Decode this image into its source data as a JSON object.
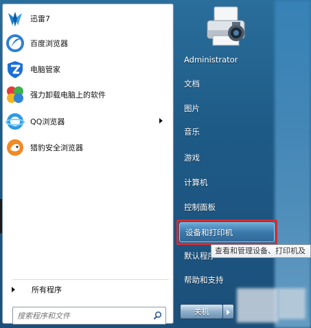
{
  "apps": [
    {
      "label": "迅雷7",
      "icon": "xunlei-icon"
    },
    {
      "label": "百度浏览器",
      "icon": "baidu-browser-icon"
    },
    {
      "label": "电脑管家",
      "icon": "pc-manager-shield-icon"
    },
    {
      "label": "强力卸载电脑上的软件",
      "icon": "uninstall-puzzle-icon"
    },
    {
      "label": "QQ浏览器",
      "icon": "qq-browser-icon",
      "has_submenu": true
    },
    {
      "label": "猎豹安全浏览器",
      "icon": "liebao-browser-icon"
    }
  ],
  "all_programs": "所有程序",
  "search": {
    "placeholder": "搜索程序和文件"
  },
  "right": {
    "user": "Administrator",
    "items": [
      "文档",
      "图片",
      "音乐",
      "游戏",
      "计算机",
      "控制面板",
      "设备和打印机",
      "默认程序",
      "帮助和支持"
    ]
  },
  "tooltip": "查看和管理设备、打印机及",
  "shutdown_label": "关机",
  "colors": {
    "highlight_border": "#d62c32",
    "menu_blue": "#1e5a86"
  }
}
